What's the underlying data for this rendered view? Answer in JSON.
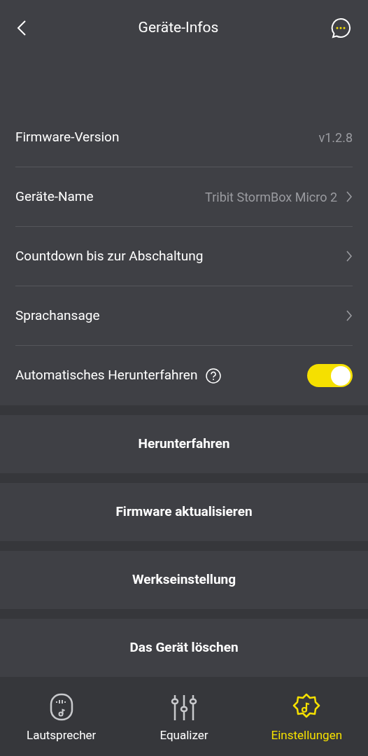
{
  "header": {
    "title": "Geräte-Infos"
  },
  "settings": [
    {
      "kind": "value",
      "label": "Firmware-Version",
      "value": "v1.2.8"
    },
    {
      "kind": "link",
      "label": "Geräte-Name",
      "value": "Tribit StormBox Micro 2"
    },
    {
      "kind": "link",
      "label": "Countdown bis zur Abschaltung"
    },
    {
      "kind": "link",
      "label": "Sprachansage"
    },
    {
      "kind": "toggle",
      "label": "Automatisches Herunterfahren",
      "on": true
    }
  ],
  "actions": [
    "Herunterfahren",
    "Firmware aktualisieren",
    "Werkseinstellung",
    "Das Gerät löschen"
  ],
  "nav": [
    {
      "kind": "speaker",
      "label": "Lautsprecher",
      "selected": false
    },
    {
      "kind": "equalizer",
      "label": "Equalizer",
      "selected": false
    },
    {
      "kind": "settings",
      "label": "Einstellungen",
      "selected": true
    }
  ]
}
